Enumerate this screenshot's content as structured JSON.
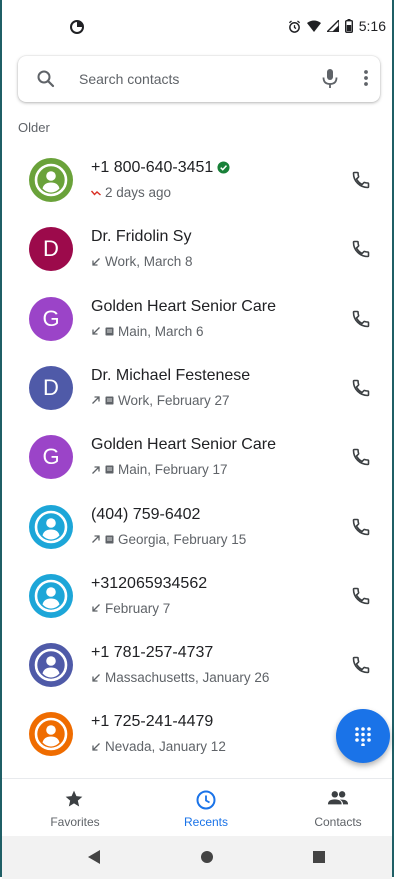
{
  "status_bar": {
    "time": "5:16"
  },
  "search": {
    "placeholder": "Search contacts"
  },
  "section": {
    "label": "Older"
  },
  "calls": [
    {
      "avatar_type": "icon",
      "avatar_color": "#6aa23a",
      "name": "+1 800-640-3451",
      "verified": true,
      "direction": "missed",
      "sim_icon": false,
      "detail": "2 days ago"
    },
    {
      "avatar_type": "letter",
      "letter": "D",
      "avatar_color": "#9c0a4b",
      "name": "Dr. Fridolin Sy",
      "verified": false,
      "direction": "incoming",
      "sim_icon": false,
      "detail": "Work, March 8"
    },
    {
      "avatar_type": "letter",
      "letter": "G",
      "avatar_color": "#9b44c8",
      "name": "Golden Heart Senior Care",
      "verified": false,
      "direction": "incoming",
      "sim_icon": true,
      "detail": "Main, March 6"
    },
    {
      "avatar_type": "letter",
      "letter": "D",
      "avatar_color": "#4f5aa8",
      "name": "Dr. Michael Festenese",
      "verified": false,
      "direction": "outgoing",
      "sim_icon": true,
      "detail": "Work, February 27"
    },
    {
      "avatar_type": "letter",
      "letter": "G",
      "avatar_color": "#9b44c8",
      "name": "Golden Heart Senior Care",
      "verified": false,
      "direction": "outgoing",
      "sim_icon": true,
      "detail": "Main, February 17"
    },
    {
      "avatar_type": "icon",
      "avatar_color": "#1da6d8",
      "name": "(404) 759-6402",
      "verified": false,
      "direction": "outgoing",
      "sim_icon": true,
      "detail": "Georgia, February 15"
    },
    {
      "avatar_type": "icon",
      "avatar_color": "#1da6d8",
      "name": "+312065934562",
      "verified": false,
      "direction": "incoming",
      "sim_icon": false,
      "detail": "February 7"
    },
    {
      "avatar_type": "icon",
      "avatar_color": "#4f5aa8",
      "name": "+1 781-257-4737",
      "verified": false,
      "direction": "incoming",
      "sim_icon": false,
      "detail": "Massachusetts, January 26"
    },
    {
      "avatar_type": "icon",
      "avatar_color": "#ef6c00",
      "name": "+1 725-241-4479",
      "verified": false,
      "direction": "incoming",
      "sim_icon": false,
      "detail": "Nevada, January 12"
    }
  ],
  "bottom_nav": {
    "favorites": "Favorites",
    "recents": "Recents",
    "contacts": "Contacts",
    "active": "recents"
  },
  "colors": {
    "accent": "#1a73e8",
    "missed": "#d93025",
    "verified": "#188038"
  }
}
